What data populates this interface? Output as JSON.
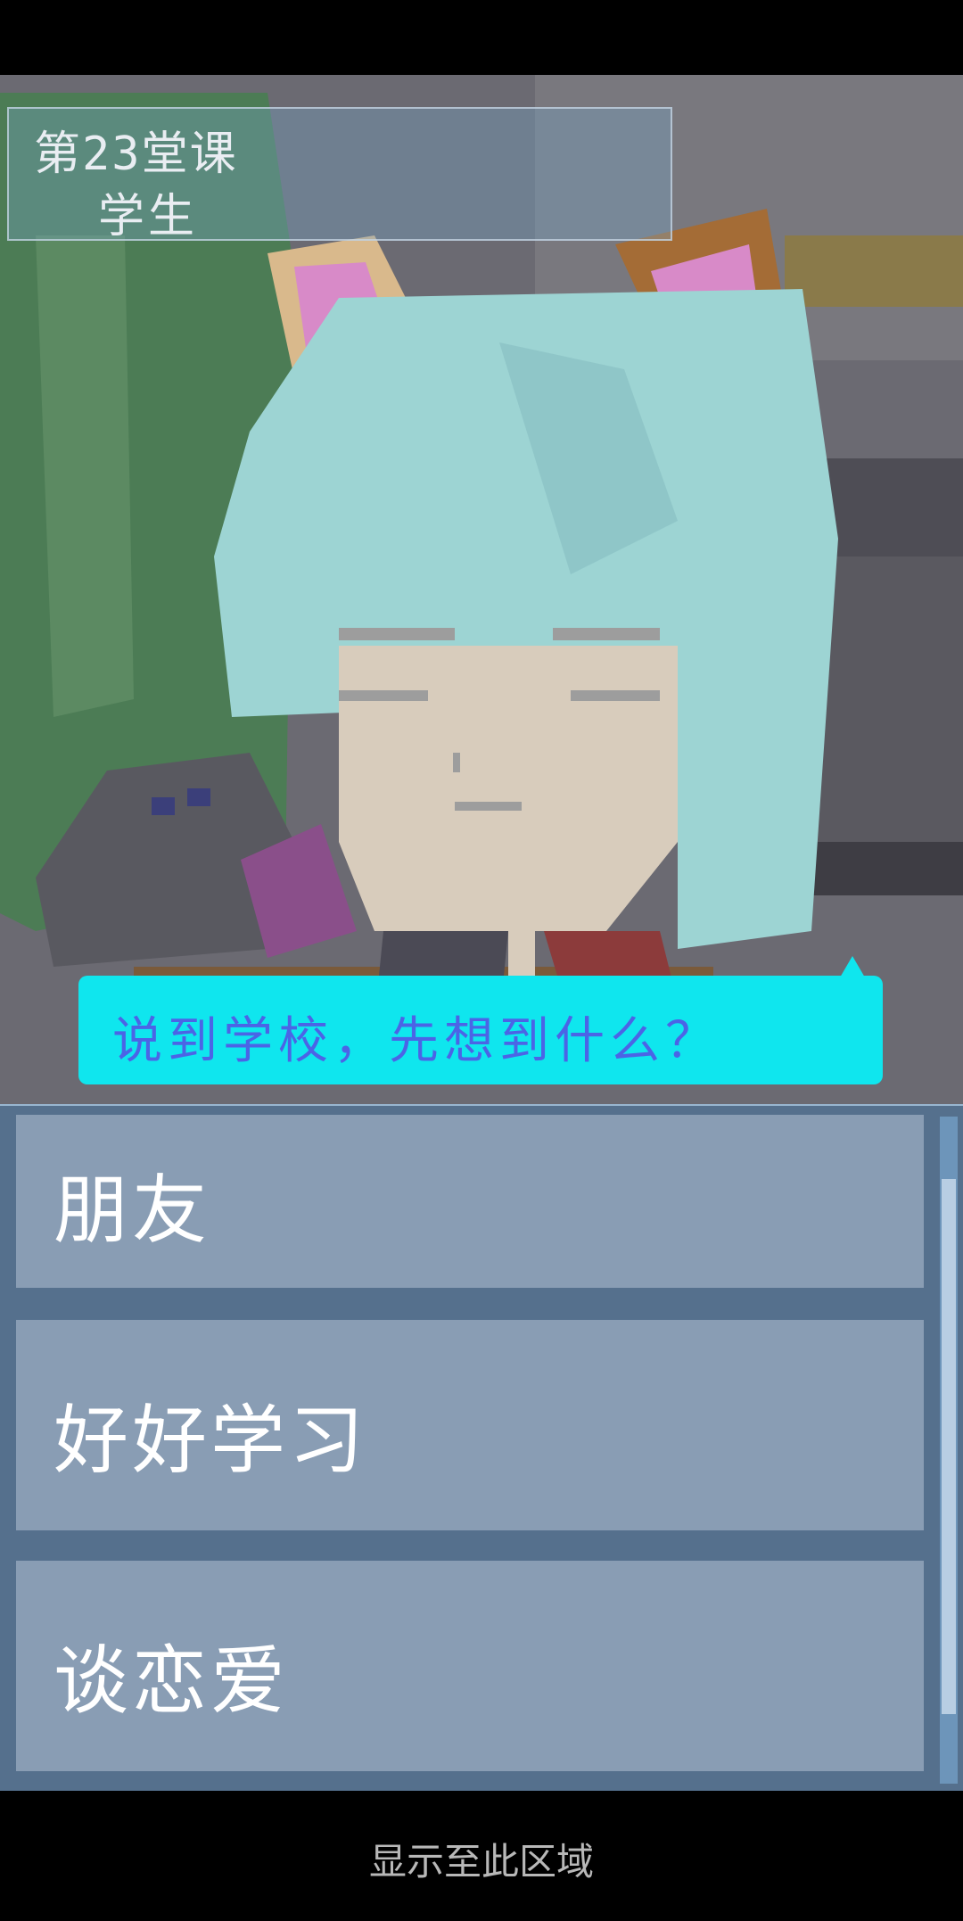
{
  "lesson": {
    "title": "第23堂课",
    "subtitle": "学生"
  },
  "dialogue": {
    "text": "说到学校，先想到什么？"
  },
  "choices": [
    {
      "label": "朋友"
    },
    {
      "label": "好好学习"
    },
    {
      "label": "谈恋爱"
    }
  ],
  "footer": {
    "hint": "显示至此区域"
  },
  "colors": {
    "bubble": "#0fe6ee",
    "bubble_text": "#4b64e6",
    "hair": "#9dd4d3",
    "ear_inner": "#d88ac8",
    "ear_outer": "#d9b98c",
    "plant": "#4c7c55"
  }
}
